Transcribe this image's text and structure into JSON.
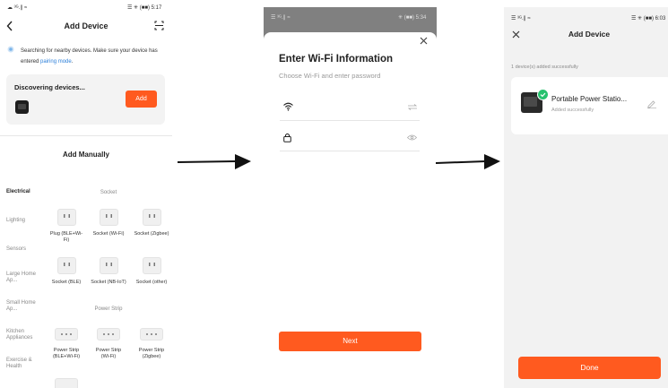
{
  "colors": {
    "accent": "#ff5a1f",
    "link": "#2b7fd9",
    "success": "#27c26e"
  },
  "panel1": {
    "status_left": "☁ ³ᴳ.∥ ≈",
    "status_right": "☰ ✳ (■■) 5:17",
    "title": "Add Device",
    "info_text": "Searching for nearby devices. Make sure your device has entered",
    "info_link": "pairing mode",
    "info_tail": ".",
    "discovering": "Discovering devices...",
    "add_button": "Add",
    "add_manually": "Add Manually",
    "categories": [
      "Electrical",
      "Lighting",
      "Sensors",
      "Large Home Ap...",
      "Small Home Ap...",
      "Kitchen Appliances",
      "Exercise & Health"
    ],
    "section_socket": "Socket",
    "section_strip": "Power Strip",
    "sockets": [
      {
        "label": "Plug (BLE+Wi-Fi)"
      },
      {
        "label": "Socket (Wi-Fi)"
      },
      {
        "label": "Socket (Zigbee)"
      },
      {
        "label": "Socket (BLE)"
      },
      {
        "label": "Socket (NB-IoT)"
      },
      {
        "label": "Socket (other)"
      }
    ],
    "strips": [
      {
        "label": "Power Strip (BLE+Wi-Fi)"
      },
      {
        "label": "Power Strip (Wi-Fi)"
      },
      {
        "label": "Power Strip (Zigbee)"
      }
    ]
  },
  "panel2": {
    "status_left": "☰ ³ᴳ.∥ ≈",
    "status_right": "✳ (■■) 5:34",
    "title": "Enter Wi-Fi Information",
    "subtitle": "Choose Wi-Fi and enter password",
    "wifi_value": "",
    "password_value": "",
    "next_button": "Next"
  },
  "panel3": {
    "status_left": "☰ ³ᴳ.∥ ≈",
    "status_right": "☰ ✳ (■■) 6:03",
    "title": "Add Device",
    "added_text": "1 device(s) added successfully",
    "device_name": "Portable Power Statio...",
    "device_status": "Added successfully",
    "done_button": "Done"
  }
}
